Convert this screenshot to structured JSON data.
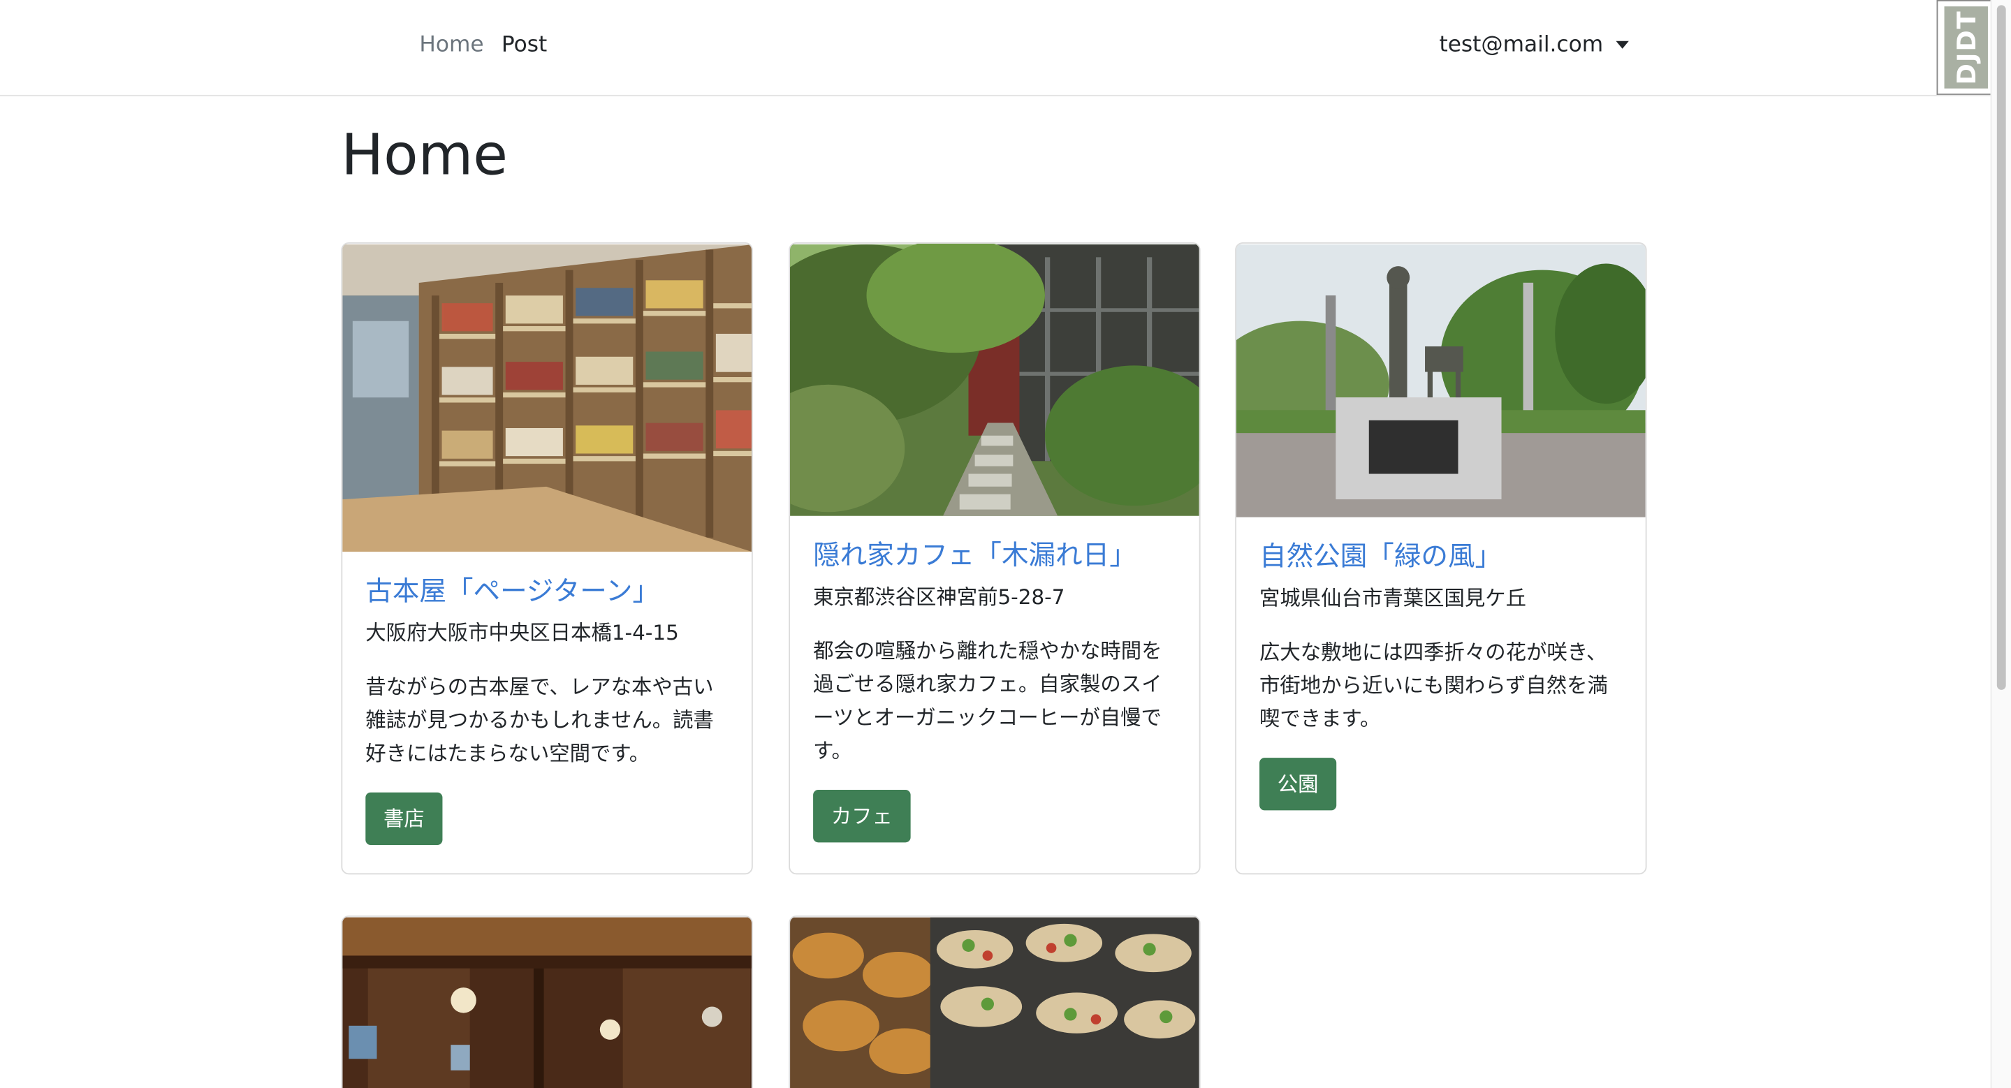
{
  "nav": {
    "home": "Home",
    "post": "Post",
    "user_email": "test@mail.com"
  },
  "djdt": "DJDT",
  "page": {
    "title": "Home"
  },
  "cards": [
    {
      "title": "古本屋「ページターン」",
      "address": "大阪府大阪市中央区日本橋1-4-15",
      "description": "昔ながらの古本屋で、レアな本や古い雑誌が見つかるかもしれません。読書好きにはたまらない空間です。",
      "tag": "書店",
      "image": "bookshop-photo"
    },
    {
      "title": "隠れ家カフェ「木漏れ日」",
      "address": "東京都渋谷区神宮前5-28-7",
      "description": "都会の喧騒から離れた穏やかな時間を過ごせる隠れ家カフェ。自家製のスイーツとオーガニックコーヒーが自慢です。",
      "tag": "カフェ",
      "image": "garden-cafe-photo"
    },
    {
      "title": "自然公園「緑の風」",
      "address": "宮城県仙台市青葉区国見ケ丘",
      "description": "広大な敷地には四季折々の花が咲き、市街地から近いにも関わらず自然を満喫できます。",
      "tag": "公園",
      "image": "park-statue-photo"
    },
    {
      "image": "classic-interior-photo"
    },
    {
      "image": "baked-food-photo"
    }
  ]
}
